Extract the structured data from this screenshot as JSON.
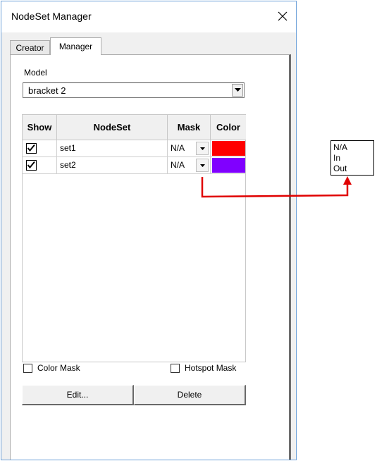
{
  "window": {
    "title": "NodeSet Manager"
  },
  "tabs": [
    {
      "label": "Creator",
      "active": false
    },
    {
      "label": "Manager",
      "active": true
    }
  ],
  "model": {
    "label": "Model",
    "value": "bracket 2"
  },
  "table": {
    "headers": [
      "Show",
      "NodeSet",
      "Mask",
      "Color"
    ],
    "rows": [
      {
        "show": true,
        "nodeset": "set1",
        "mask": "N/A",
        "color": "#ff0000"
      },
      {
        "show": true,
        "nodeset": "set2",
        "mask": "N/A",
        "color": "#8000ff"
      }
    ]
  },
  "options": {
    "color_mask": {
      "label": "Color Mask",
      "checked": false
    },
    "hotspot_mask": {
      "label": "Hotspot Mask",
      "checked": false
    }
  },
  "buttons": {
    "edit": "Edit...",
    "delete": "Delete"
  },
  "mask_dropdown_options": [
    "N/A",
    "In",
    "Out"
  ],
  "colors": {
    "window_border": "#6a9fd8",
    "callout_arrow": "#e00000"
  }
}
